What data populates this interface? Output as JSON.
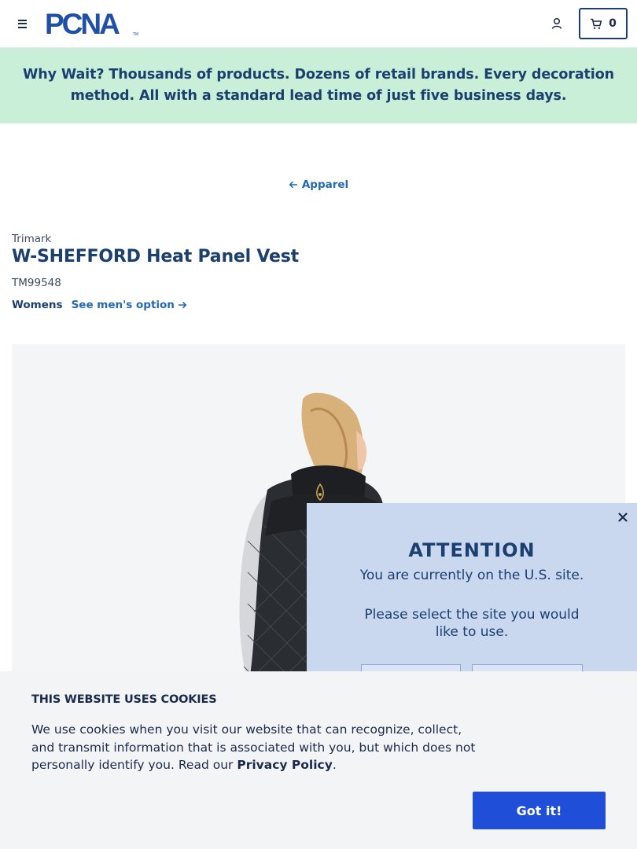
{
  "header": {
    "logo_text": "PCNA",
    "cart_count": "0"
  },
  "promo": {
    "lead": "Why Wait?",
    "text": " Thousands of products. Dozens of retail brands. Every decoration method. All with a standard lead time of just five business days."
  },
  "breadcrumb": {
    "label": "Apparel"
  },
  "product": {
    "brand": "Trimark",
    "title": "W-SHEFFORD Heat Panel Vest",
    "sku": "TM99548",
    "gender": "Womens",
    "alt_link": "See men's option"
  },
  "popup": {
    "title": "ATTENTION",
    "line1": "You are currently on the U.S. site.",
    "line2": "Please select the site you would like to use."
  },
  "cookie": {
    "heading": "THIS WEBSITE USES COOKIES",
    "body": "We use cookies when you visit our website that can recognize, collect, and transmit information that is associated with you, but which does not personally identify you. Read our ",
    "link": "Privacy Policy",
    "end": ".",
    "button": "Got it!"
  },
  "colors": {
    "brand_blue": "#1b3f6e",
    "link_blue": "#2469b3",
    "banner_green": "#c9efd9",
    "popup_bg": "#cad8ef",
    "button_blue": "#1f4fd8"
  },
  "icons": [
    "hamburger-menu-icon",
    "account-icon",
    "cart-icon",
    "arrow-left-icon",
    "arrow-right-icon",
    "close-icon"
  ]
}
